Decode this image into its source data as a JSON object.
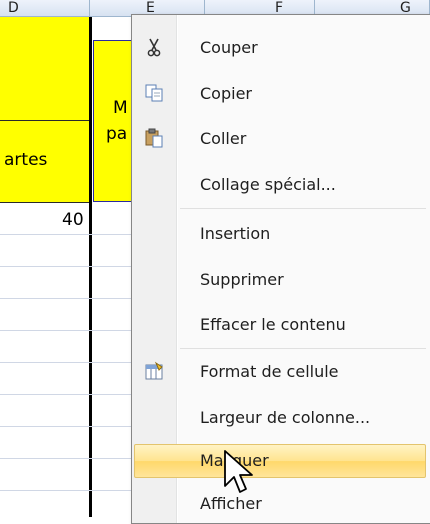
{
  "sheet": {
    "col_d": "D",
    "col_e": "E",
    "col_f": "F",
    "col_g": "G",
    "d_header_text": "artes",
    "e_header_line1": "M",
    "e_header_line2": "pa",
    "d_value": "40"
  },
  "menu": {
    "items": [
      {
        "label": "Couper",
        "icon": "scissors-icon"
      },
      {
        "label": "Copier",
        "icon": "copy-icon"
      },
      {
        "label": "Coller",
        "icon": "paste-icon"
      },
      {
        "label": "Collage spécial...",
        "icon": ""
      },
      {
        "label": "Insertion",
        "icon": ""
      },
      {
        "label": "Supprimer",
        "icon": ""
      },
      {
        "label": "Effacer le contenu",
        "icon": ""
      },
      {
        "label": "Format de cellule",
        "icon": "format-cells-icon"
      },
      {
        "label": "Largeur de colonne...",
        "icon": ""
      },
      {
        "label": "Masquer",
        "icon": ""
      },
      {
        "label": "Afficher",
        "icon": ""
      }
    ],
    "highlighted_index": 9
  },
  "colors": {
    "highlight": "#ffe48f",
    "cell_fill": "#ffff00",
    "header_bg": "#dbe5f1"
  }
}
